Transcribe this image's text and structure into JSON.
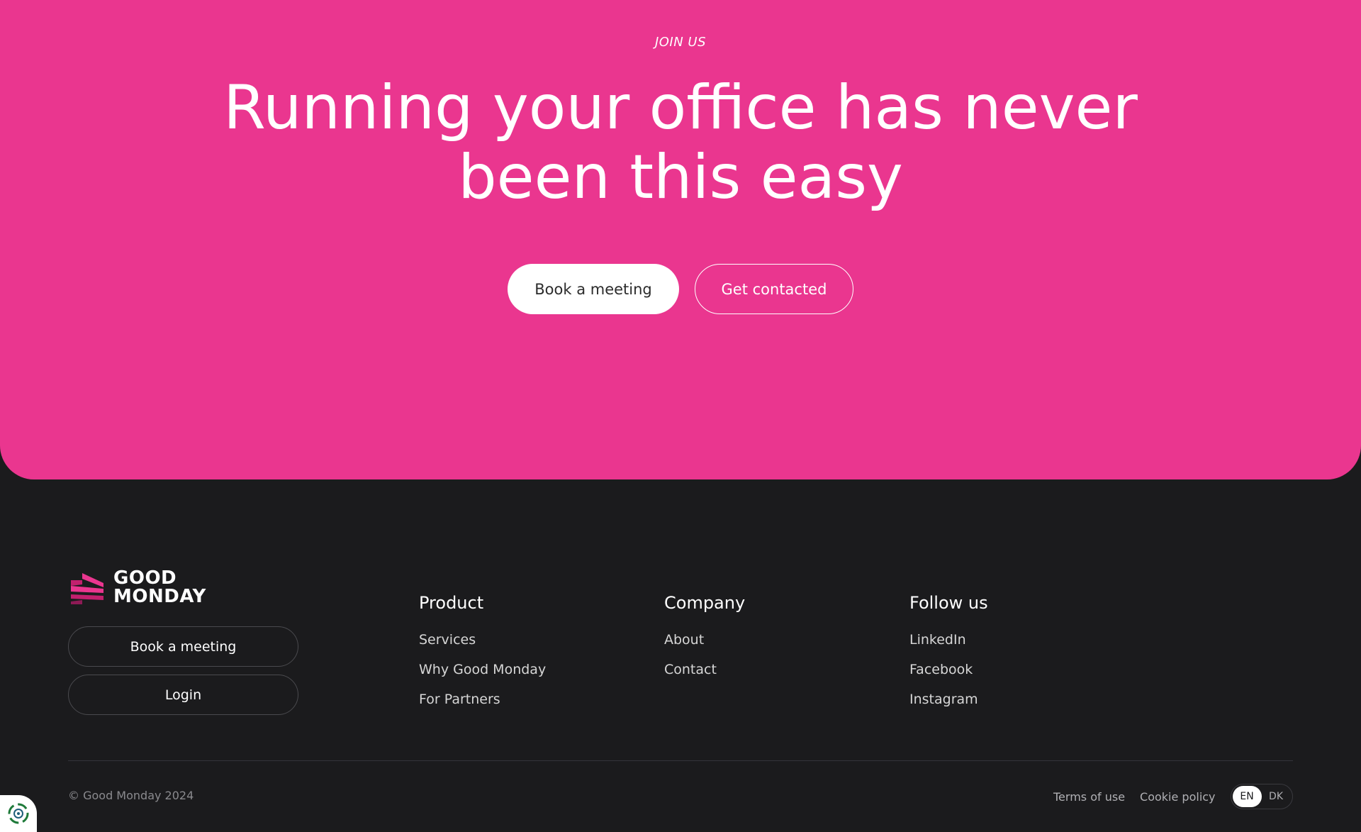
{
  "hero": {
    "eyebrow": "JOIN US",
    "headline": "Running your office has never been this easy",
    "primary_button": "Book a meeting",
    "secondary_button": "Get contacted"
  },
  "footer": {
    "logo_line1": "GOOD",
    "logo_line2": "MONDAY",
    "book_button": "Book a meeting",
    "login_button": "Login",
    "columns": [
      {
        "heading": "Product",
        "links": [
          "Services",
          "Why Good Monday",
          "For Partners"
        ]
      },
      {
        "heading": "Company",
        "links": [
          "About",
          "Contact"
        ]
      },
      {
        "heading": "Follow us",
        "links": [
          "LinkedIn",
          "Facebook",
          "Instagram"
        ]
      }
    ],
    "copyright": "© Good Monday 2024",
    "legal": {
      "terms": "Terms of use",
      "cookie": "Cookie policy"
    },
    "languages": {
      "active": "EN",
      "other": "DK"
    }
  },
  "colors": {
    "brand_pink": "#ea368f",
    "footer_bg": "#1b1b1d"
  },
  "icons": {
    "logo": "good-monday-logo-icon",
    "cookie": "cookie-settings-icon"
  }
}
